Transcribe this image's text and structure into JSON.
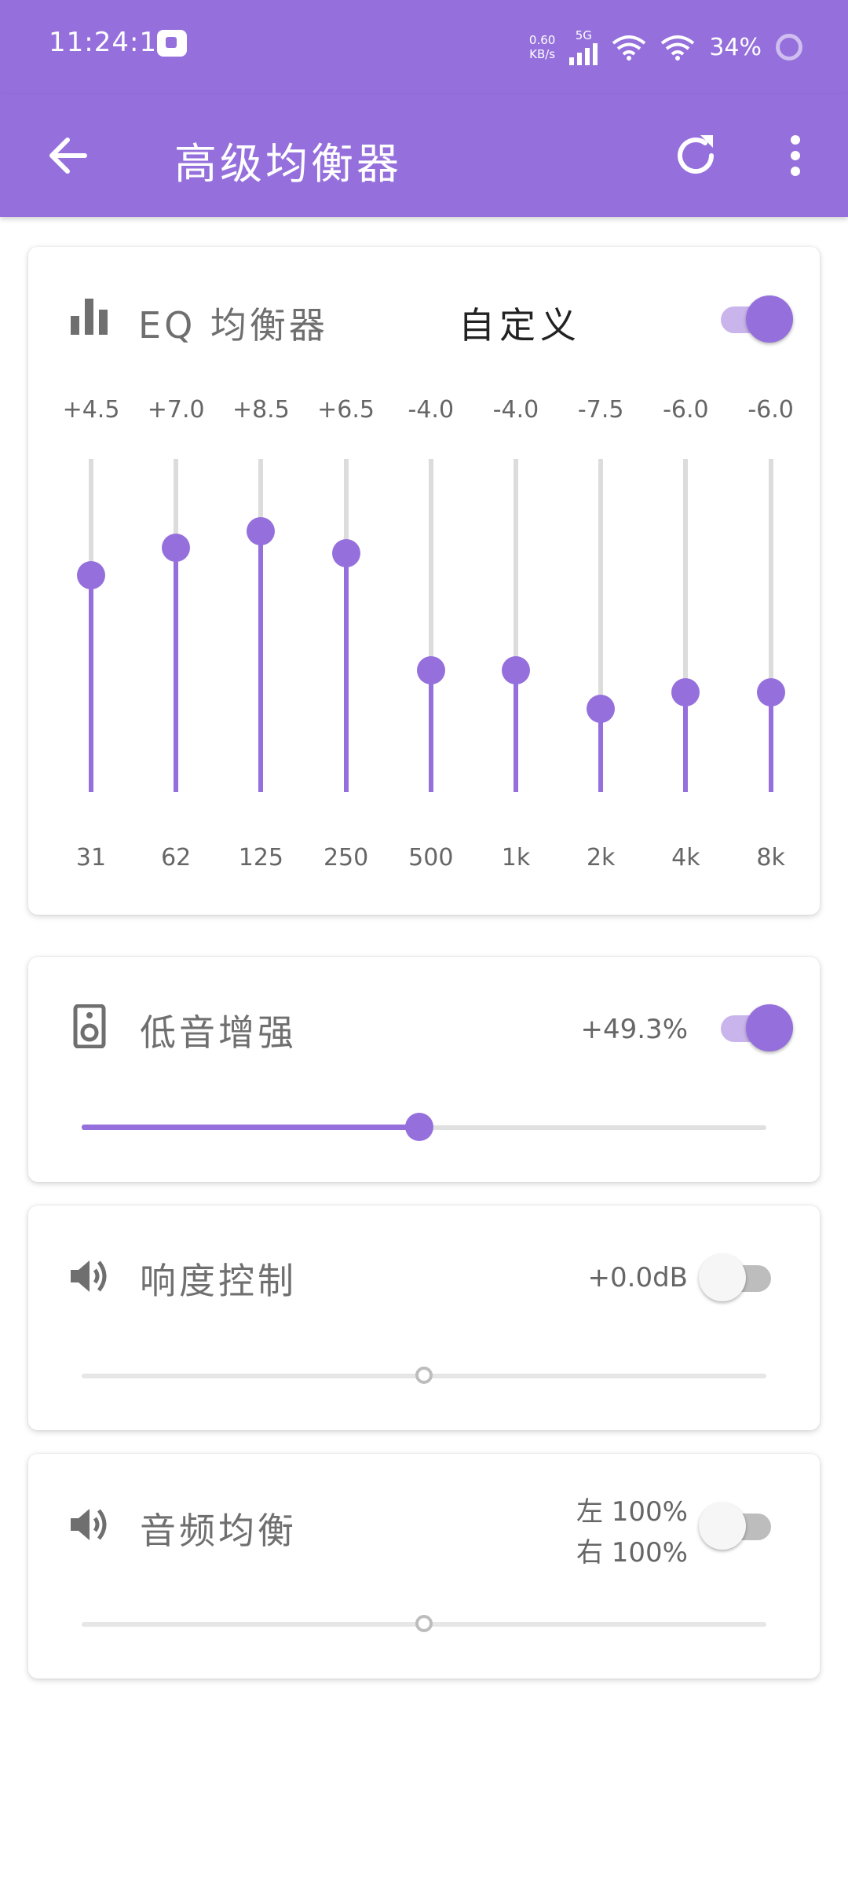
{
  "status": {
    "time": "11:24:14",
    "net_speed_value": "0.60",
    "net_speed_unit": "KB/s",
    "network": "5G",
    "battery": "34%"
  },
  "appbar": {
    "title": "高级均衡器"
  },
  "eq": {
    "title": "EQ 均衡器",
    "mode": "自定义",
    "enabled": true,
    "range_db": [
      -15,
      15
    ],
    "bands": [
      {
        "gain_label": "+4.5",
        "gain": 4.5,
        "freq": "31"
      },
      {
        "gain_label": "+7.0",
        "gain": 7.0,
        "freq": "62"
      },
      {
        "gain_label": "+8.5",
        "gain": 8.5,
        "freq": "125"
      },
      {
        "gain_label": "+6.5",
        "gain": 6.5,
        "freq": "250"
      },
      {
        "gain_label": "-4.0",
        "gain": -4.0,
        "freq": "500"
      },
      {
        "gain_label": "-4.0",
        "gain": -4.0,
        "freq": "1k"
      },
      {
        "gain_label": "-7.5",
        "gain": -7.5,
        "freq": "2k"
      },
      {
        "gain_label": "-6.0",
        "gain": -6.0,
        "freq": "4k"
      },
      {
        "gain_label": "-6.0",
        "gain": -6.0,
        "freq": "8k"
      }
    ]
  },
  "bass": {
    "title": "低音增强",
    "value": "+49.3%",
    "level": 0.493,
    "enabled": true
  },
  "loudness": {
    "title": "响度控制",
    "value": "+0.0dB",
    "level": 0.5,
    "enabled": false
  },
  "balance": {
    "title": "音频均衡",
    "left": "左 100%",
    "right": "右 100%",
    "level": 0.5,
    "enabled": false
  },
  "colors": {
    "accent": "#9570dc",
    "accent_light": "#c9b5ec",
    "track": "#dcdcdc"
  }
}
